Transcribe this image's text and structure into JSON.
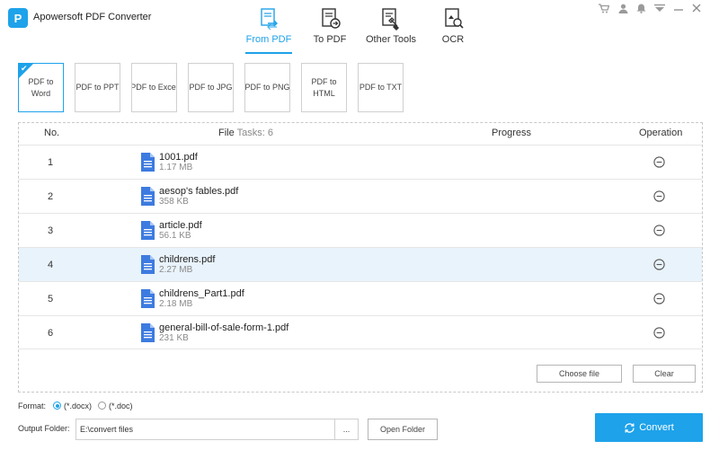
{
  "app": {
    "logo_letter": "P",
    "title": "Apowersoft PDF Converter"
  },
  "main_tabs": [
    {
      "label": "From PDF",
      "icon": "from-pdf-icon",
      "active": true
    },
    {
      "label": "To PDF",
      "icon": "to-pdf-icon",
      "active": false
    },
    {
      "label": "Other Tools",
      "icon": "tools-icon",
      "active": false
    },
    {
      "label": "OCR",
      "icon": "ocr-icon",
      "active": false
    }
  ],
  "window_controls": [
    "cart-icon",
    "user-icon",
    "bell-icon",
    "menu-icon",
    "minimize-icon",
    "close-icon"
  ],
  "sub_tabs": [
    {
      "label": "PDF to Word",
      "active": true
    },
    {
      "label": "PDF to PPT",
      "active": false
    },
    {
      "label": "PDF to Excel",
      "active": false
    },
    {
      "label": "PDF to JPG",
      "active": false
    },
    {
      "label": "PDF to PNG",
      "active": false
    },
    {
      "label": "PDF to HTML",
      "active": false
    },
    {
      "label": "PDF to TXT",
      "active": false
    }
  ],
  "table": {
    "headers": {
      "no": "No.",
      "file": "File",
      "tasks": "Tasks: 6",
      "progress": "Progress",
      "operation": "Operation"
    },
    "rows": [
      {
        "no": "1",
        "name": "1001.pdf",
        "size": "1.17 MB"
      },
      {
        "no": "2",
        "name": "aesop's fables.pdf",
        "size": "358 KB"
      },
      {
        "no": "3",
        "name": "article.pdf",
        "size": "56.1 KB"
      },
      {
        "no": "4",
        "name": "childrens.pdf",
        "size": "2.27 MB"
      },
      {
        "no": "5",
        "name": "childrens_Part1.pdf",
        "size": "2.18 MB"
      },
      {
        "no": "6",
        "name": "general-bill-of-sale-form-1.pdf",
        "size": "231 KB"
      }
    ],
    "selected_row": 4
  },
  "buttons": {
    "choose_file": "Choose file",
    "clear": "Clear",
    "browse": "...",
    "open_folder": "Open Folder",
    "convert": "Convert"
  },
  "format": {
    "label": "Format:",
    "options": [
      {
        "label": "(*.docx)",
        "checked": true
      },
      {
        "label": "(*.doc)",
        "checked": false
      }
    ]
  },
  "output": {
    "label": "Output Folder:",
    "value": "E:\\convert files"
  },
  "colors": {
    "accent": "#1ea2ea",
    "selected_row": "#e9f3fb"
  }
}
